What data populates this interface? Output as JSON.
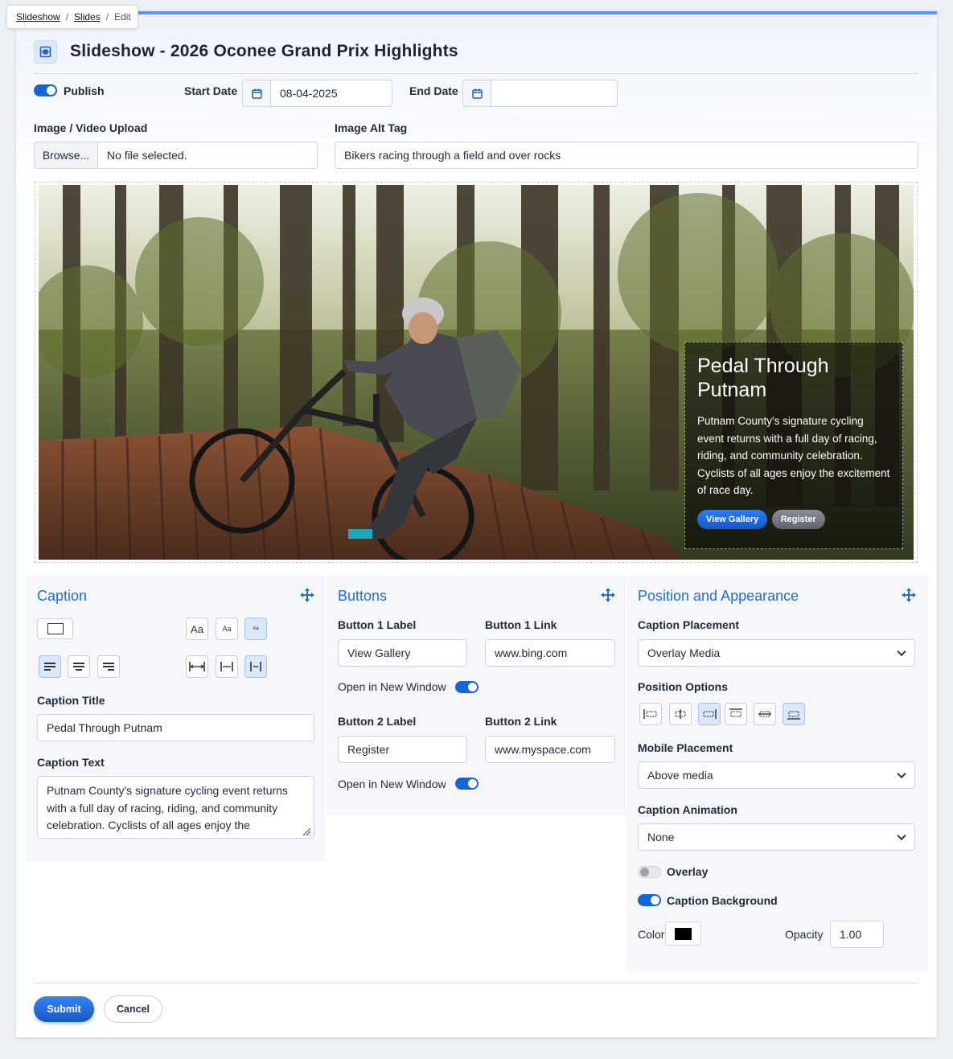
{
  "breadcrumb": {
    "items": [
      "Slideshow",
      "Slides"
    ],
    "current": "Edit"
  },
  "header": {
    "title": "Slideshow - 2026 Oconee Grand Prix Highlights"
  },
  "publish": {
    "label": "Publish",
    "on": true
  },
  "start_date": {
    "label": "Start Date",
    "value": "08-04-2025"
  },
  "end_date": {
    "label": "End Date",
    "value": ""
  },
  "upload": {
    "label": "Image / Video Upload",
    "browse_label": "Browse...",
    "file_text": "No file selected."
  },
  "alt_tag": {
    "label": "Image Alt Tag",
    "value": "Bikers racing through a field and over rocks"
  },
  "preview": {
    "title": "Pedal Through Putnam",
    "text": "Putnam County's signature cycling event returns with a full day of racing, riding, and community celebration. Cyclists of all ages enjoy the excitement of race day.",
    "button1": "View Gallery",
    "button2": "Register"
  },
  "caption_panel": {
    "heading": "Caption",
    "title_label": "Caption Title",
    "title_value": "Pedal Through Putnam",
    "text_label": "Caption Text",
    "text_value": "Putnam County's signature cycling event returns with a full day of racing, riding, and community celebration. Cyclists of all ages enjoy the",
    "size_options": [
      "Aa",
      "Aa",
      "Aa"
    ]
  },
  "buttons_panel": {
    "heading": "Buttons",
    "b1_label_label": "Button 1 Label",
    "b1_label_value": "View Gallery",
    "b1_link_label": "Button 1 Link",
    "b1_link_value": "www.bing.com",
    "b1_new_window": "Open in New Window",
    "b2_label_label": "Button 2 Label",
    "b2_label_value": "Register",
    "b2_link_label": "Button 2 Link",
    "b2_link_value": "www.myspace.com",
    "b2_new_window": "Open in New Window"
  },
  "position_panel": {
    "heading": "Position and Appearance",
    "placement_label": "Caption Placement",
    "placement_value": "Overlay Media",
    "options_label": "Position Options",
    "mobile_label": "Mobile Placement",
    "mobile_value": "Above media",
    "animation_label": "Caption Animation",
    "animation_value": "None",
    "overlay_label": "Overlay",
    "overlay_on": false,
    "caption_bg_label": "Caption Background",
    "caption_bg_on": true,
    "color_label": "Color",
    "color_value": "#000000",
    "opacity_label": "Opacity",
    "opacity_value": "1.00"
  },
  "actions": {
    "submit": "Submit",
    "cancel": "Cancel"
  },
  "colors": {
    "accent": "#1565d8",
    "heading_blue": "#1f6fd1",
    "top_border": "#5b95f0"
  }
}
